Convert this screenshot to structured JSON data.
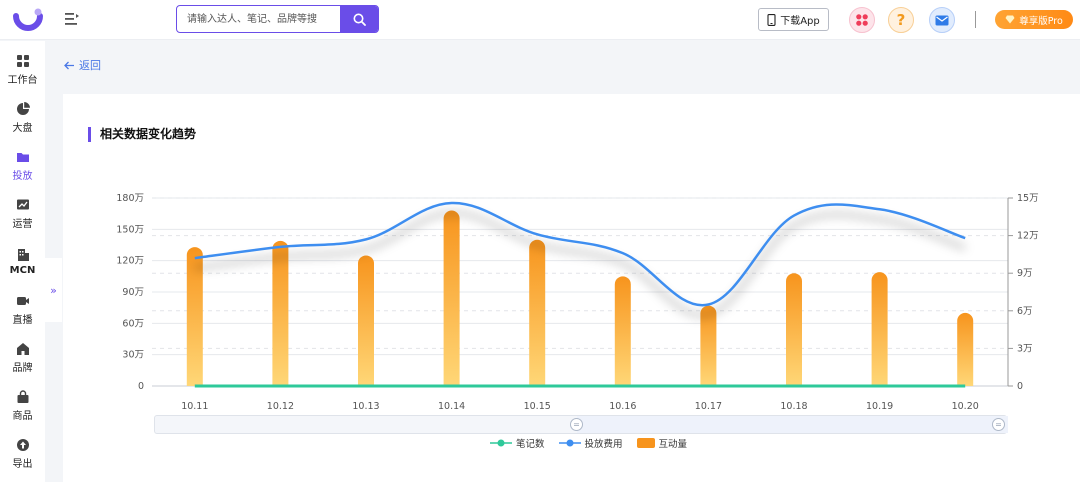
{
  "header": {
    "search_placeholder": "请输入达人、笔记、品牌等搜",
    "download_label": "下载App",
    "help_symbol": "?",
    "pro_label": "尊享版Pro"
  },
  "sidebar": {
    "items": [
      {
        "label": "工作台",
        "icon": "grid-icon"
      },
      {
        "label": "大盘",
        "icon": "pie-icon"
      },
      {
        "label": "投放",
        "icon": "folder-icon"
      },
      {
        "label": "运营",
        "icon": "trend-icon"
      },
      {
        "label": "MCN",
        "icon": "building-icon"
      },
      {
        "label": "直播",
        "icon": "video-icon"
      },
      {
        "label": "品牌",
        "icon": "house-icon"
      },
      {
        "label": "商品",
        "icon": "bag-icon"
      },
      {
        "label": "导出",
        "icon": "upload-icon"
      }
    ],
    "active_index": 2,
    "collapse_symbol": "»"
  },
  "back_label": "返回",
  "card_title": "相关数据变化趋势",
  "colors": {
    "accent": "#6a4de8",
    "bar_top": "#f7941d",
    "bar_bottom": "#ffd777",
    "line_spend": "#3e8ef0",
    "line_notes": "#2ec99a"
  },
  "chart_data": {
    "type": "bar",
    "categories": [
      "10.11",
      "10.12",
      "10.13",
      "10.14",
      "10.15",
      "10.16",
      "10.17",
      "10.18",
      "10.19",
      "10.20"
    ],
    "y_left": {
      "ticks": [
        "0",
        "30万",
        "60万",
        "90万",
        "120万",
        "150万",
        "180万"
      ],
      "max": 1800000
    },
    "y_right": {
      "ticks": [
        "0",
        "3万",
        "6万",
        "9万",
        "12万",
        "15万"
      ],
      "max": 150000
    },
    "series": [
      {
        "name": "笔记数",
        "type": "line",
        "axis": "left",
        "values": [
          0,
          0,
          0,
          0,
          0,
          0,
          0,
          0,
          0,
          0
        ]
      },
      {
        "name": "投放费用",
        "type": "line",
        "axis": "right",
        "values": [
          102000,
          111000,
          117000,
          146000,
          121000,
          106000,
          65000,
          136000,
          141000,
          118000
        ]
      },
      {
        "name": "互动量",
        "type": "bar",
        "axis": "left",
        "values": [
          1330000,
          1390000,
          1250000,
          1680000,
          1400000,
          1050000,
          770000,
          1080000,
          1090000,
          700000
        ]
      }
    ],
    "grid": true,
    "legend_position": "bottom"
  }
}
